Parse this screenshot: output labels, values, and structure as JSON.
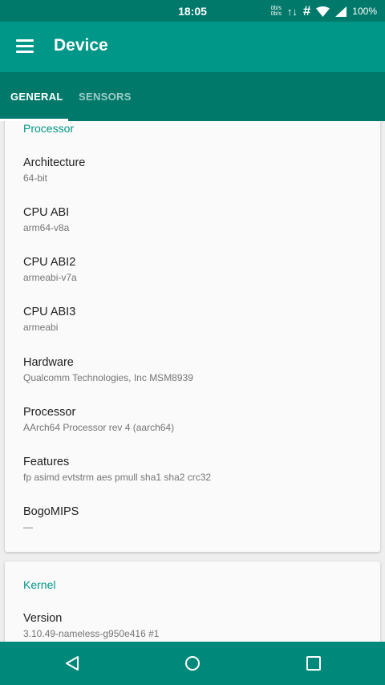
{
  "status_bar": {
    "time": "18:05",
    "net_up": "0b/s",
    "net_down": "0b/s",
    "data_arrows": "↑↓",
    "hash": "#",
    "battery": "100%"
  },
  "app_bar": {
    "title": "Device"
  },
  "tabs": [
    {
      "label": "GENERAL",
      "selected": true
    },
    {
      "label": "SENSORS",
      "selected": false
    }
  ],
  "processor": {
    "header": "Processor",
    "items": [
      {
        "label": "Architecture",
        "value": "64-bit"
      },
      {
        "label": "CPU ABI",
        "value": "arm64-v8a"
      },
      {
        "label": "CPU ABI2",
        "value": "armeabi-v7a"
      },
      {
        "label": "CPU ABI3",
        "value": "armeabi"
      },
      {
        "label": "Hardware",
        "value": "Qualcomm Technologies, Inc MSM8939"
      },
      {
        "label": "Processor",
        "value": "AArch64 Processor rev 4 (aarch64)"
      },
      {
        "label": "Features",
        "value": "fp asimd evtstrm aes pmull sha1 sha2 crc32"
      },
      {
        "label": "BogoMIPS",
        "value": "—"
      }
    ]
  },
  "kernel": {
    "header": "Kernel",
    "items": [
      {
        "label": "Version",
        "value": "3.10.49-nameless-g950e416 #1"
      }
    ]
  },
  "colors": {
    "primary": "#009688",
    "primary_dark": "#00796b",
    "accent_text": "#009688"
  },
  "icons": {
    "menu": "menu-icon",
    "wifi": "wifi-icon",
    "signal": "signal-icon",
    "back": "back-icon",
    "home": "home-icon",
    "recents": "recents-icon"
  }
}
